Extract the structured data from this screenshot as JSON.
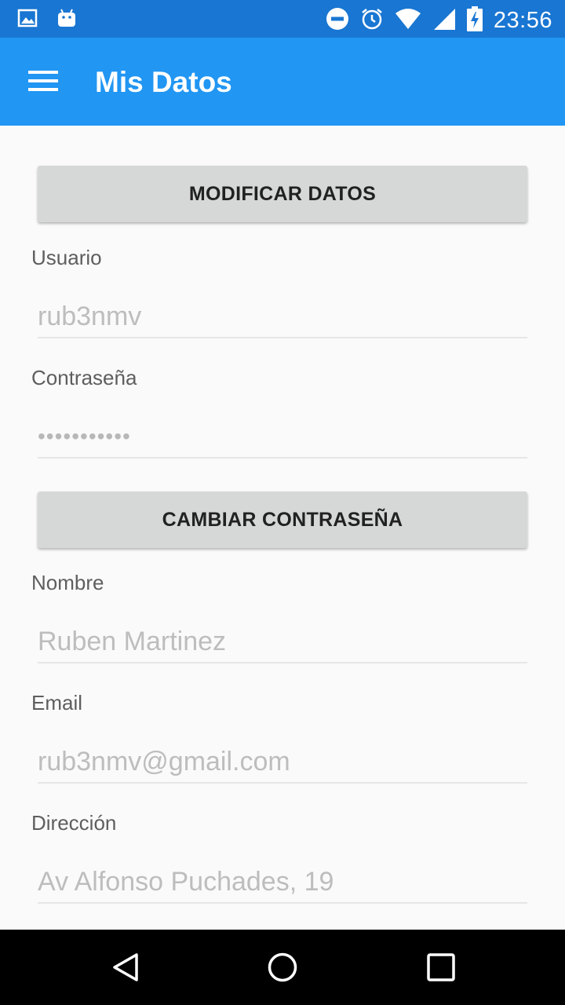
{
  "status_bar": {
    "time": "23:56",
    "icons": [
      "image-icon",
      "android-icon",
      "do-not-disturb-icon",
      "alarm-icon",
      "wifi-icon",
      "signal-icon",
      "battery-charging-icon"
    ]
  },
  "app_bar": {
    "title": "Mis Datos",
    "menu_icon": "hamburger-menu-icon"
  },
  "form": {
    "modify_button": "MODIFICAR DATOS",
    "usuario_label": "Usuario",
    "usuario_value": "rub3nmv",
    "password_label": "Contraseña",
    "password_value": "•••••••••••",
    "change_password_button": "CAMBIAR CONTRASEÑA",
    "nombre_label": "Nombre",
    "nombre_value": "Ruben Martinez",
    "email_label": "Email",
    "email_value": "rub3nmv@gmail.com",
    "direccion_label": "Dirección",
    "direccion_value": "Av Alfonso Puchades, 19"
  },
  "nav_bar": {
    "icons": [
      "back-icon",
      "home-icon",
      "recents-icon"
    ]
  },
  "colors": {
    "status_bar": "#1976d2",
    "app_bar": "#2196f3",
    "button_bg": "#d6d7d7",
    "background": "#fafafa"
  }
}
